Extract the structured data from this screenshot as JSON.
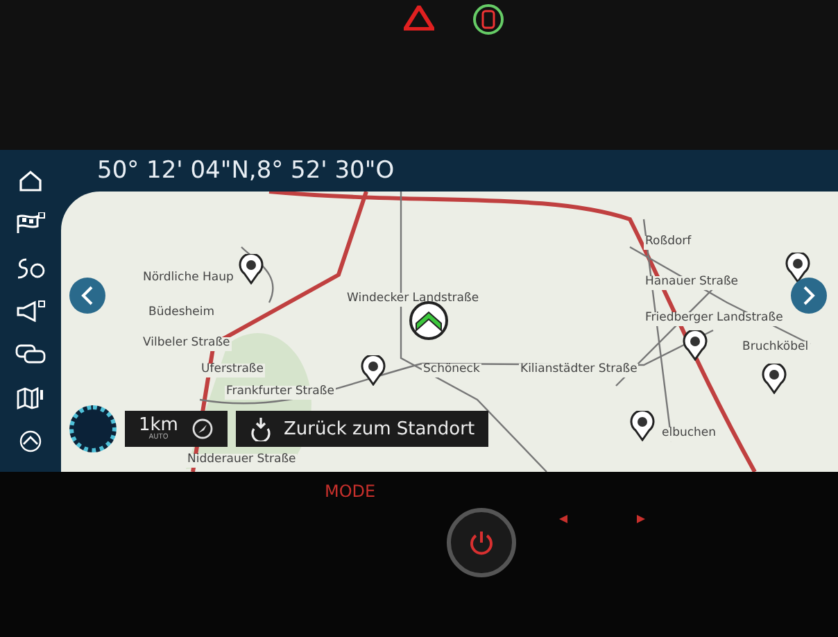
{
  "coordinates": "50° 12' 04\"N,8° 52' 30\"O",
  "map_labels": [
    "Roßdorf",
    "Nördliche Haup",
    "Hanauer Straße",
    "Windecker Landstraße",
    "Büdesheim",
    "Friedberger Landstraße",
    "Vilbeler Straße",
    "Bruchköbel",
    "Uferstraße",
    "Schöneck",
    "Kilianstädter Straße",
    "Frankfurter Straße",
    "elbuchen",
    "Nidderauer Straße"
  ],
  "scale": {
    "distance": "1km",
    "mode": "AUTO"
  },
  "return_button": "Zurück zum Standort",
  "hardware": {
    "mode_button": "MODE"
  }
}
